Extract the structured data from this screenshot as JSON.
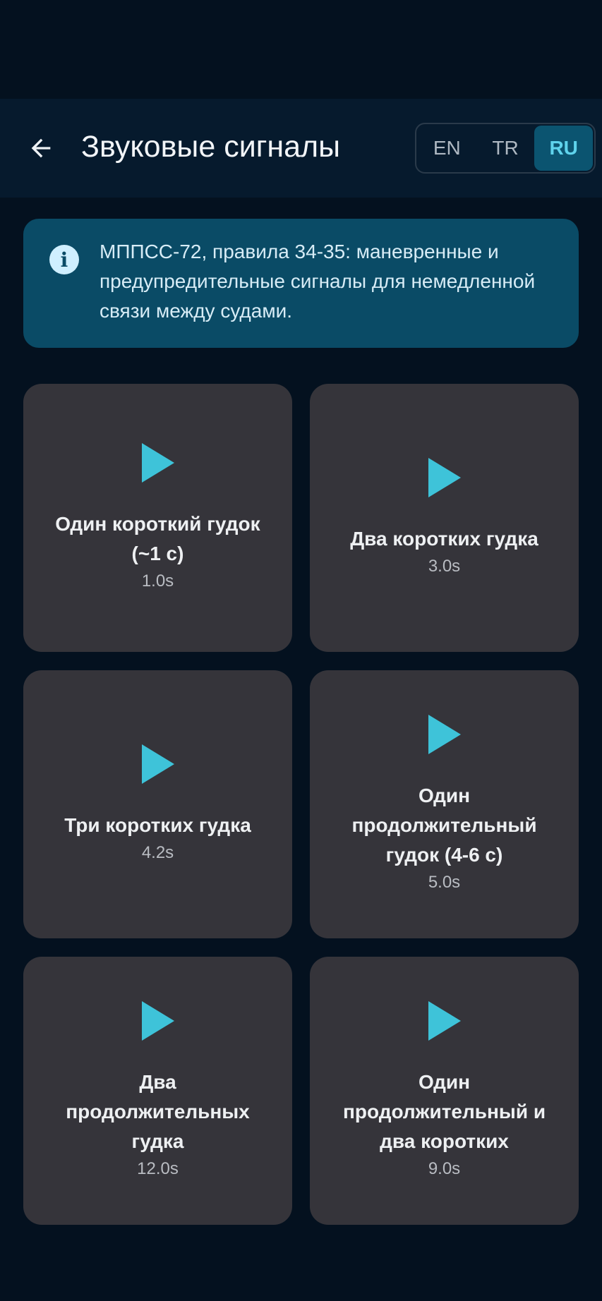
{
  "header": {
    "title": "Звуковые сигналы",
    "back_icon": "arrow-left-icon"
  },
  "languages": {
    "options": [
      "EN",
      "TR",
      "RU"
    ],
    "selected": "RU"
  },
  "info": {
    "icon": "info-icon",
    "text": "МППСС-72, правила 34-35: маневренные и предупредительные сигналы для немедленной связи между судами."
  },
  "signals": [
    {
      "title": "Один короткий гудок (~1 с)",
      "duration": "1.0s"
    },
    {
      "title": "Два коротких гудка",
      "duration": "3.0s"
    },
    {
      "title": "Три коротких гудка",
      "duration": "4.2s"
    },
    {
      "title": "Один продолжительный гудок (4-6 с)",
      "duration": "5.0s"
    },
    {
      "title": "Два продолжительных гудка",
      "duration": "12.0s"
    },
    {
      "title": "Один продолжительный и два коротких",
      "duration": "9.0s"
    }
  ],
  "colors": {
    "background": "#04111f",
    "appbar": "#061a2d",
    "info_card": "#0a4b66",
    "card": "#35343a",
    "accent": "#3ec3d9"
  }
}
